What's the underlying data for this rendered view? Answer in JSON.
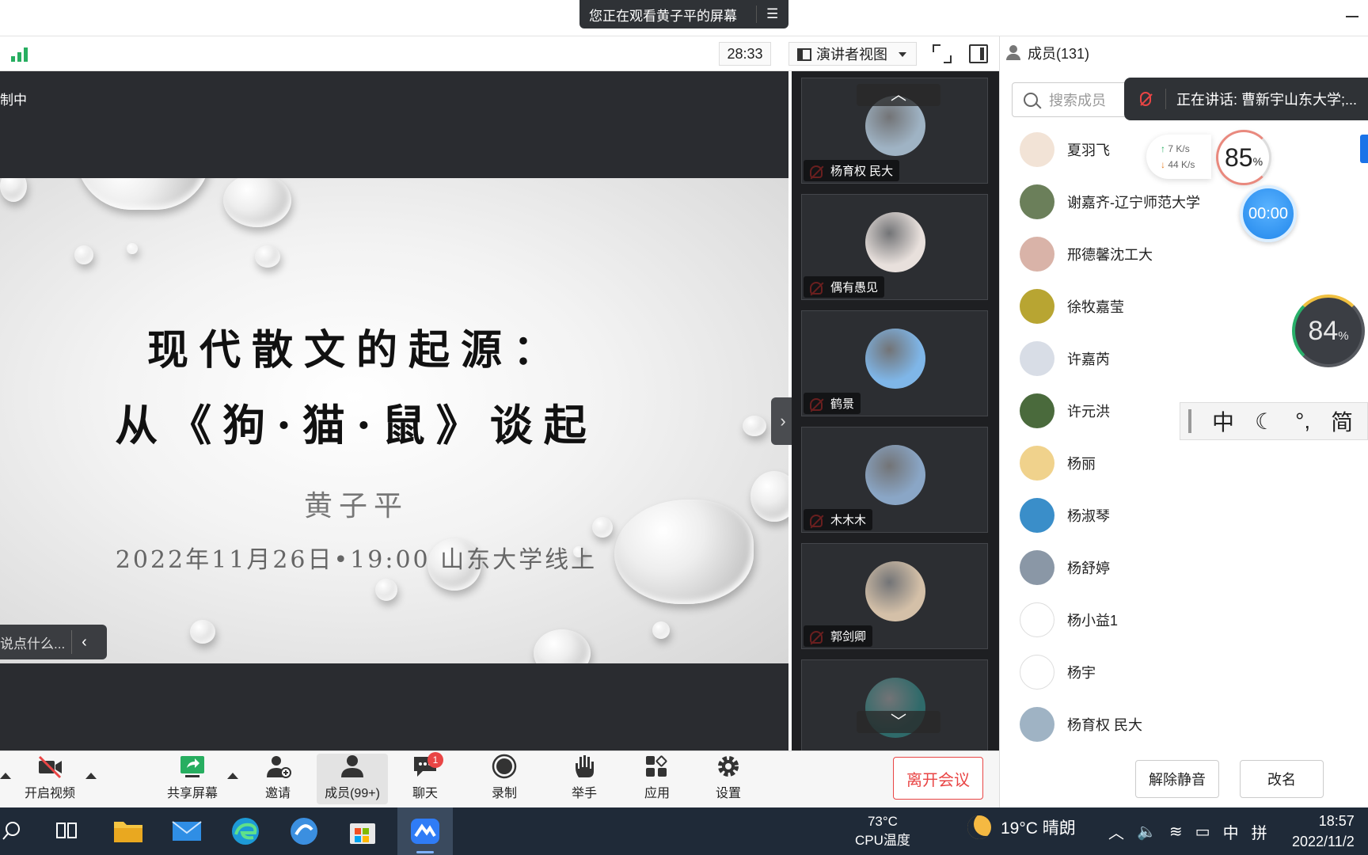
{
  "banner": {
    "text": "您正在观看黄子平的屏幕"
  },
  "meeting_bar": {
    "timer": "28:33",
    "view_mode": "演讲者视图"
  },
  "share": {
    "recording_label": "制中",
    "chat_placeholder": "说点什么...",
    "slide": {
      "title_line1": "现代散文的起源：",
      "title_line2": "从《狗·猫·鼠》谈起",
      "author": "黄子平",
      "date_line": "2022年11月26日•19:00 山东大学线上"
    }
  },
  "gallery": {
    "tiles": [
      {
        "name": "杨育权 民大",
        "color": "#9fb3c4"
      },
      {
        "name": "偶有愚见",
        "color": "#e8e0dc"
      },
      {
        "name": "鹤景",
        "color": "#7fb6e8"
      },
      {
        "name": "木木木",
        "color": "#8aa6c6"
      },
      {
        "name": "郭剑卿",
        "color": "#d4c0a8"
      },
      {
        "name": "",
        "color": "#2f6a6a"
      }
    ]
  },
  "members_panel": {
    "header": "成员(131)",
    "search_placeholder": "搜索成员",
    "speaking": "正在讲话: 曹新宇山东大学;...",
    "members": [
      {
        "name": "夏羽飞",
        "color": "#f2e3d6"
      },
      {
        "name": "谢嘉齐-辽宁师范大学",
        "color": "#6b7f5a"
      },
      {
        "name": "邢德馨沈工大",
        "color": "#d9b3a8"
      },
      {
        "name": "徐牧嘉莹",
        "color": "#b8a532"
      },
      {
        "name": "许嘉芮",
        "color": "#d8dde6"
      },
      {
        "name": "许元洪",
        "color": "#4a6a3c"
      },
      {
        "name": "杨丽",
        "color": "#f0d28c"
      },
      {
        "name": "杨淑琴",
        "color": "#3a8ec9"
      },
      {
        "name": "杨舒婷",
        "color": "#8a97a6"
      },
      {
        "name": "杨小益1",
        "color": "#ffffff"
      },
      {
        "name": "杨宇",
        "color": "#ffffff"
      },
      {
        "name": "杨育权 民大",
        "color": "#9fb3c4"
      }
    ],
    "unmute_label": "解除静音",
    "rename_label": "改名"
  },
  "widgets": {
    "upload_speed": "7",
    "download_speed": "44",
    "speed_unit": "K/s",
    "ram_value": "85",
    "timer": "00:00",
    "cpu_value": "84",
    "percent": "%",
    "ime": [
      "中",
      "☾",
      "°,",
      "简",
      "☺"
    ]
  },
  "toolbar": {
    "video": "开启视频",
    "share": "共享屏幕",
    "invite": "邀请",
    "members": "成员(99+)",
    "chat": "聊天",
    "chat_badge": "1",
    "record": "录制",
    "raise_hand": "举手",
    "apps": "应用",
    "settings": "设置",
    "leave": "离开会议"
  },
  "taskbar": {
    "cpu_temp_value": "73°C",
    "cpu_temp_label": "CPU温度",
    "weather": "19°C 晴朗",
    "tray_lang": "中",
    "tray_ime": "拼",
    "time": "18:57",
    "date": "2022/11/2"
  },
  "colors": {
    "accent_blue": "#1a73e8",
    "alert_red": "#e94545"
  }
}
